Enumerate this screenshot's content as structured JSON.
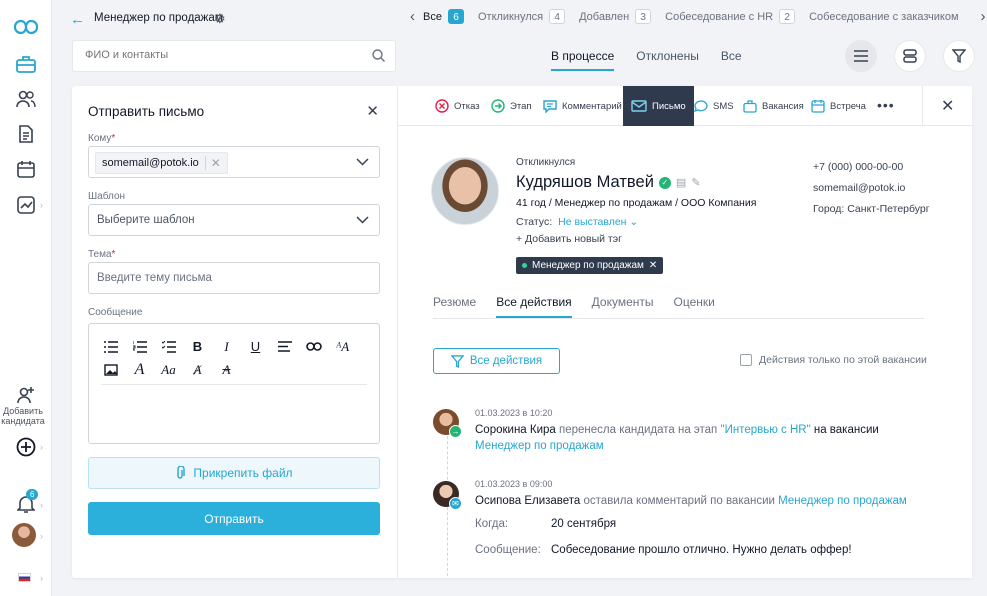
{
  "rail": {
    "add_candidate": "Добавить кандидата",
    "notif_count": "6"
  },
  "topbar": {
    "vacancy_title": "Менеджер по продажам",
    "stages": [
      {
        "label": "Все",
        "count": "6"
      },
      {
        "label": "Откликнулся",
        "count": "4"
      },
      {
        "label": "Добавлен",
        "count": "3"
      },
      {
        "label": "Собеседование с HR",
        "count": "2"
      },
      {
        "label": "Собеседование с заказчиком",
        "count": ""
      }
    ]
  },
  "search": {
    "placeholder": "ФИО и контакты"
  },
  "main_tabs": [
    "В процессе",
    "Отклонены",
    "Все"
  ],
  "email": {
    "title": "Отправить письмо",
    "to_label": "Кому",
    "to_value": "somemail@potok.io",
    "template_label": "Шаблон",
    "template_placeholder": "Выберите шаблон",
    "subject_label": "Тема",
    "subject_placeholder": "Введите тему письма",
    "message_label": "Сообщение",
    "attach_label": "Прикрепить файл",
    "send_label": "Отправить"
  },
  "actions": [
    "Отказ",
    "Этап",
    "Комментарий",
    "Письмо",
    "SMS",
    "Вакансия",
    "Встреча"
  ],
  "candidate": {
    "status": "Откликнулся",
    "name": "Кудряшов Матвей",
    "subtitle": "41 год / Менеджер по продажам / ООО Компания",
    "status_label": "Статус:",
    "status_value": "Не выставлен",
    "add_tag": "+ Добавить новый тэг",
    "tag": "Менеджер по продажам",
    "phone": "+7 (000) 000-00-00",
    "email": "somemail@potok.io",
    "city": "Город: Санкт-Петербург"
  },
  "card_tabs": [
    "Резюме",
    "Все действия",
    "Документы",
    "Оценки"
  ],
  "filter": {
    "button": "Все действия",
    "only_vacancy": "Действия только по этой вакансии"
  },
  "events": [
    {
      "date": "01.03.2023 в 10:20",
      "author": "Сорокина Кира",
      "action": " перенесла кандидата на этап ",
      "stage": "\"Интервью с HR\"",
      "mid": " на вакансии",
      "vacancy": "Менеджер по продажам"
    },
    {
      "date": "01.03.2023 в 09:00",
      "author": "Осипова Елизавета",
      "action": " оставила комментарий по вакансии ",
      "vacancy": "Менеджер по продажам",
      "when_label": "Когда:",
      "when_value": "20 сентября",
      "msg_label": "Сообщение:",
      "msg_value": "Собеседование прошло отлично. Нужно делать оффер!"
    }
  ],
  "colors": {
    "accent": "#27a6cf",
    "dark": "#2f3b4c",
    "success": "#22b573"
  }
}
